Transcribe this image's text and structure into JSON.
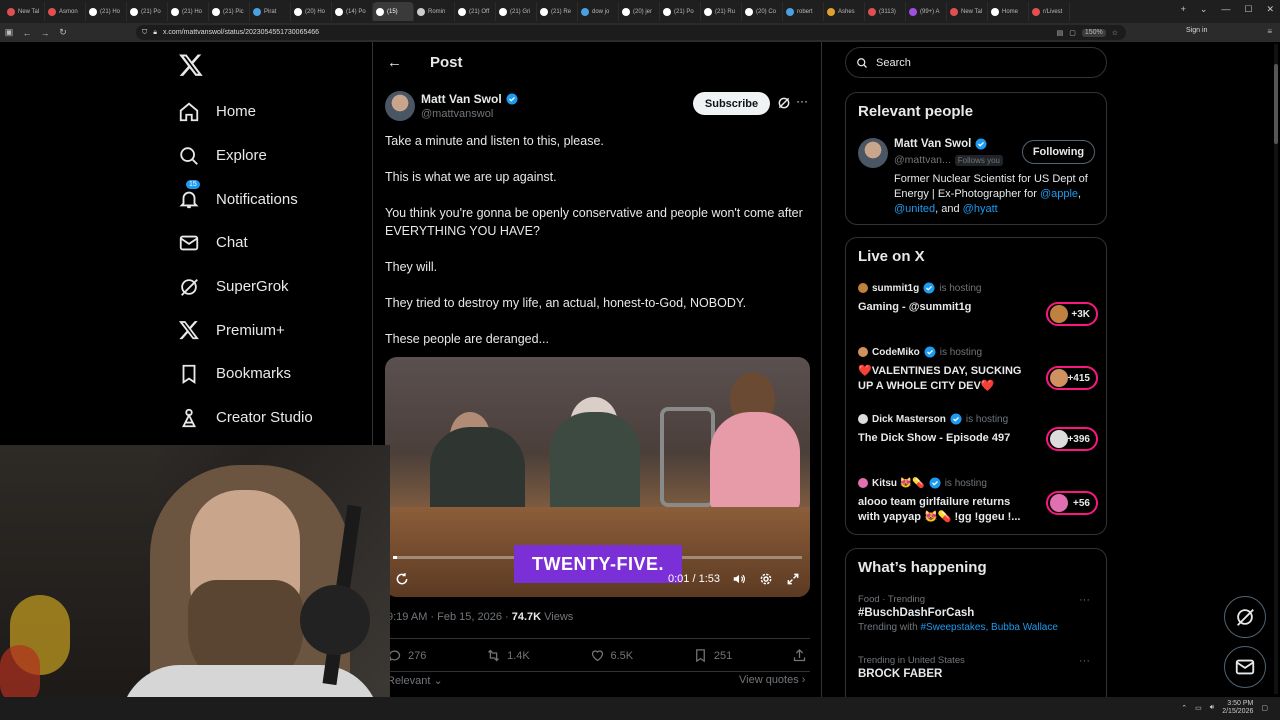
{
  "browser": {
    "tabs": [
      {
        "label": "New Tal",
        "color": "#e05050"
      },
      {
        "label": "Asmon",
        "color": "#e05050"
      },
      {
        "label": "(21) Ho",
        "color": "#ffffff"
      },
      {
        "label": "(21) Po",
        "color": "#ffffff"
      },
      {
        "label": "(21) Ho",
        "color": "#ffffff"
      },
      {
        "label": "(21) Pic",
        "color": "#ffffff"
      },
      {
        "label": "Pirat",
        "color": "#4aa0e0"
      },
      {
        "label": "(20) Ho",
        "color": "#ffffff"
      },
      {
        "label": "(14) Po",
        "color": "#ffffff"
      },
      {
        "label": "(15) ",
        "color": "#ffffff"
      },
      {
        "label": "Romin",
        "color": "#cccccc"
      },
      {
        "label": "(21) Off",
        "color": "#ffffff"
      },
      {
        "label": "(21) Gri",
        "color": "#ffffff"
      },
      {
        "label": "(21) Re",
        "color": "#ffffff"
      },
      {
        "label": "dow jo",
        "color": "#4aa0e0"
      },
      {
        "label": "(20) jer",
        "color": "#ffffff"
      },
      {
        "label": "(21) Po",
        "color": "#ffffff"
      },
      {
        "label": "(21) Ru",
        "color": "#ffffff"
      },
      {
        "label": "(20) Co",
        "color": "#ffffff"
      },
      {
        "label": "robert",
        "color": "#4aa0e0"
      },
      {
        "label": "Ashes",
        "color": "#e0a030"
      },
      {
        "label": "(3113)",
        "color": "#e05050"
      },
      {
        "label": "(99+) A",
        "color": "#a050e0"
      },
      {
        "label": "New Tal",
        "color": "#e05050"
      },
      {
        "label": "Home",
        "color": "#ffffff"
      },
      {
        "label": "r/Livest",
        "color": "#e05050"
      }
    ],
    "active_tab_index": 9,
    "url": "x.com/mattvanswol/status/2023054551730065466",
    "zoom": "150%",
    "sign_in": "Sign in"
  },
  "nav": {
    "items": [
      {
        "label": "Home",
        "icon": "home-icon"
      },
      {
        "label": "Explore",
        "icon": "search-icon"
      },
      {
        "label": "Notifications",
        "icon": "bell-icon",
        "badge": "15"
      },
      {
        "label": "Chat",
        "icon": "mail-icon"
      },
      {
        "label": "SuperGrok",
        "icon": "grok-icon"
      },
      {
        "label": "Premium+",
        "icon": "x-icon"
      },
      {
        "label": "Bookmarks",
        "icon": "bookmark-icon"
      },
      {
        "label": "Creator Studio",
        "icon": "creator-icon"
      }
    ]
  },
  "post": {
    "header_title": "Post",
    "author_name": "Matt Van Swol",
    "author_handle": "@mattvanswol",
    "subscribe_label": "Subscribe",
    "paragraphs": [
      "Take a minute and listen to this, please.",
      "This is what we are up against.",
      "You think you're gonna be openly conservative and people won't come after EVERYTHING YOU HAVE?",
      "They will.",
      "They tried to destroy my life, an actual, honest-to-God, NOBODY.",
      "These people are deranged..."
    ],
    "video": {
      "caption": "TWENTY-FIVE.",
      "time": "0:01 / 1:53",
      "progress": 0.01
    },
    "timestamp": "9:19 AM · Feb 15, 2026 · ",
    "views_count": "74.7K",
    "views_label": " Views",
    "replies": "276",
    "reposts": "1.4K",
    "likes": "6.5K",
    "bookmarks": "251",
    "relevant_label": "Relevant",
    "view_quotes_label": "View quotes"
  },
  "sidebar": {
    "search_placeholder": "Search",
    "relevant_people": {
      "title": "Relevant people",
      "name": "Matt Van Swol",
      "handle": "@mattvan...",
      "follows_you": "Follows you",
      "following_label": "Following",
      "bio_text": "Former Nuclear Scientist for US Dept of Energy | Ex-Photographer for",
      "mention1": "@apple",
      "sep1": ", ",
      "mention2": "@united",
      "sep2": ", and ",
      "mention3": "@hyatt"
    },
    "live": {
      "title": "Live on X",
      "hosting_label": "is hosting",
      "items": [
        {
          "host": "summit1g",
          "title": "Gaming - @summit1g",
          "count": "+3K",
          "color": "#c08040"
        },
        {
          "host": "CodeMiko",
          "title": "❤️VALENTINES DAY, SUCKING UP A WHOLE CITY DEV❤️",
          "count": "+415",
          "color": "#d09060"
        },
        {
          "host": "Dick Masterson",
          "title": "The Dick Show - Episode 497",
          "count": "+396",
          "color": "#dddddd"
        },
        {
          "host": "Kitsu 😻💊",
          "title": "alooo team girlfailure returns with yapyap 😻💊 !gg !ggeu !...",
          "count": "+56",
          "color": "#e070b0"
        }
      ]
    },
    "happening": {
      "title": "What’s happening",
      "trends": [
        {
          "category": "Food · Trending",
          "name": "#BuschDashForCash",
          "with_label": "Trending with ",
          "with_tags": "#Sweepstakes, Bubba Wallace"
        },
        {
          "category": "Trending in United States",
          "name": "BROCK FABER",
          "with_label": "",
          "with_tags": ""
        }
      ]
    }
  },
  "taskbar": {
    "time": "3:50 PM",
    "date": "2/15/2026"
  },
  "colors": {
    "accent": "#1d9bf0",
    "live_ring": "#f91880",
    "caption_bg": "#7b2fd6"
  }
}
